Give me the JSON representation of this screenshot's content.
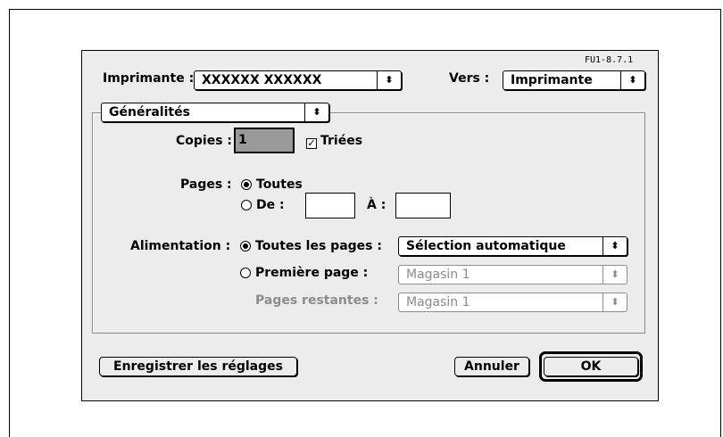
{
  "version": "FU1-8.7.1",
  "printer": {
    "label": "Imprimante :",
    "value": "XXXXXX XXXXXX",
    "destination_label": "Vers :",
    "destination_value": "Imprimante",
    "arrow_glyph": "⬍"
  },
  "section": {
    "value": "Généralités"
  },
  "copies": {
    "label": "Copies :",
    "value": "1",
    "collated_label": "Triées",
    "collated_checked": true,
    "check_glyph": "✓"
  },
  "pages": {
    "label": "Pages :",
    "all_label": "Toutes",
    "from_label": "De :",
    "to_label": "À :",
    "from_value": "",
    "to_value": ""
  },
  "paper_source": {
    "label": "Alimentation :",
    "all_pages_label": "Toutes les pages :",
    "all_pages_value": "Sélection automatique",
    "first_page_label": "Première page :",
    "first_page_value": "Magasin 1",
    "remaining_label": "Pages restantes :",
    "remaining_value": "Magasin 1"
  },
  "buttons": {
    "save_settings": "Enregistrer les réglages",
    "cancel": "Annuler",
    "ok": "OK"
  }
}
